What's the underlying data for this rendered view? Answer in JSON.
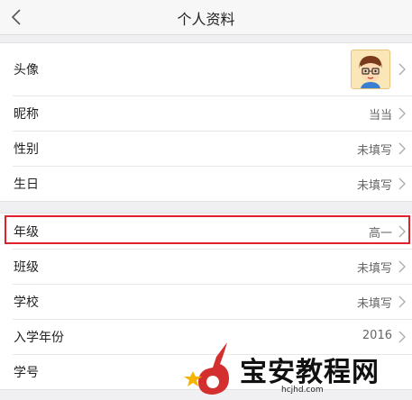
{
  "header": {
    "title": "个人资料"
  },
  "groups": [
    {
      "rows": [
        {
          "label": "头像"
        },
        {
          "label": "昵称",
          "value": "当当"
        },
        {
          "label": "性别",
          "value": "未填写"
        },
        {
          "label": "生日",
          "value": "未填写"
        }
      ]
    },
    {
      "rows": [
        {
          "label": "年级",
          "value": "高一"
        },
        {
          "label": "班级",
          "value": "未填写"
        },
        {
          "label": "学校",
          "value": "未填写"
        },
        {
          "label": "入学年份",
          "value": "2016"
        },
        {
          "label": "学号",
          "value": ""
        }
      ]
    }
  ],
  "watermark": {
    "text": "宝安教程网",
    "url": "hcjhd.com"
  },
  "colors": {
    "highlight": "#e0202a",
    "background": "#f0f0f2"
  }
}
